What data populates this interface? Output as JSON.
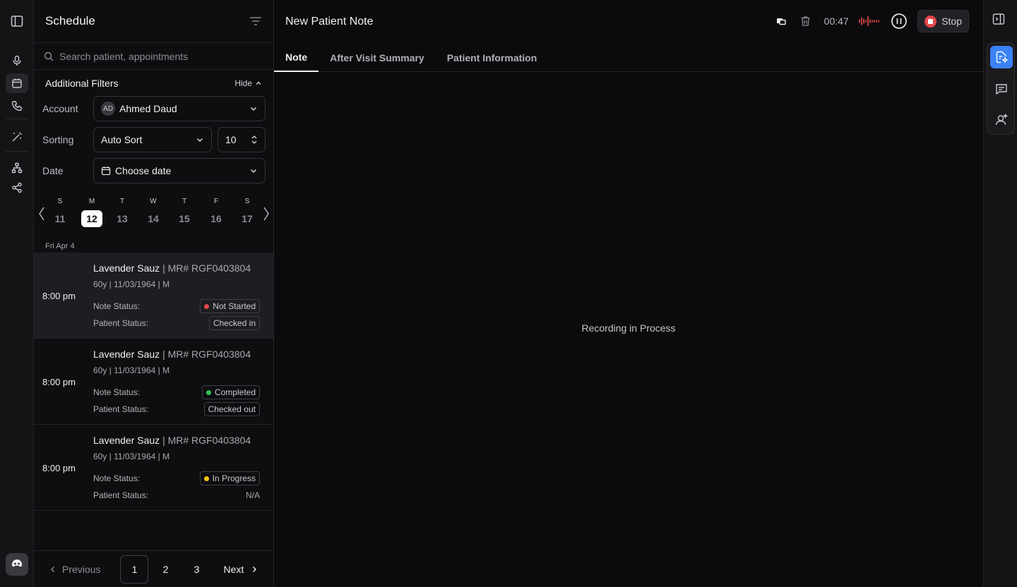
{
  "rail": {
    "icons": [
      "sidebar-toggle-icon",
      "microphone-icon",
      "calendar-icon",
      "phone-icon",
      "magic-wand-icon",
      "sitemap-icon",
      "share-icon",
      "bot-avatar-icon"
    ]
  },
  "schedule": {
    "title": "Schedule",
    "search_placeholder": "Search patient, appointments",
    "filters": {
      "title": "Additional Filters",
      "hide_label": "Hide",
      "account_label": "Account",
      "account_initials": "AD",
      "account_value": "Ahmed Daud",
      "sorting_label": "Sorting",
      "sorting_value": "Auto Sort",
      "count_value": "10",
      "date_label": "Date",
      "date_placeholder": "Choose date"
    },
    "week": [
      {
        "dn": "S",
        "dd": "11"
      },
      {
        "dn": "M",
        "dd": "12"
      },
      {
        "dn": "T",
        "dd": "13"
      },
      {
        "dn": "W",
        "dd": "14"
      },
      {
        "dn": "T",
        "dd": "15"
      },
      {
        "dn": "F",
        "dd": "16"
      },
      {
        "dn": "S",
        "dd": "17"
      }
    ],
    "selected_day": "12",
    "date_group": "Fri Apr 4",
    "appointments": [
      {
        "time": "8:00 pm",
        "name": "Lavender Sauz",
        "mr": " | MR# RGF0403804",
        "meta": "60y | 11/03/1964 | M",
        "note_label": "Note Status:",
        "note_status": "Not Started",
        "note_color": "#e5484d",
        "patient_label": "Patient Status:",
        "patient_status": "Checked in"
      },
      {
        "time": "8:00 pm",
        "name": "Lavender Sauz",
        "mr": " | MR# RGF0403804",
        "meta": "60y | 11/03/1964 | M",
        "note_label": "Note Status:",
        "note_status": "Completed",
        "note_color": "#30c453",
        "patient_label": "Patient Status:",
        "patient_status": "Checked out"
      },
      {
        "time": "8:00 pm",
        "name": "Lavender Sauz",
        "mr": " | MR# RGF0403804",
        "meta": "60y | 11/03/1964 | M",
        "note_label": "Note Status:",
        "note_status": "In Progress",
        "note_color": "#f5c518",
        "patient_label": "Patient Status:",
        "patient_status": "N/A"
      }
    ],
    "pager": {
      "previous": "Previous",
      "pages": [
        "1",
        "2",
        "3"
      ],
      "current": "1",
      "next": "Next"
    }
  },
  "main": {
    "title": "New Patient Note",
    "timer": "00:47",
    "stop_label": "Stop",
    "tabs": [
      "Note",
      "After Visit Summary",
      "Patient Information"
    ],
    "active_tab": "Note",
    "message": "Recording in Process",
    "waveform_color": "#e5484d"
  },
  "right_rail": {
    "icons": [
      "panel-right-icon",
      "note-edit-icon",
      "chat-icon",
      "assistant-icon"
    ],
    "accent": "#3b82f6"
  }
}
